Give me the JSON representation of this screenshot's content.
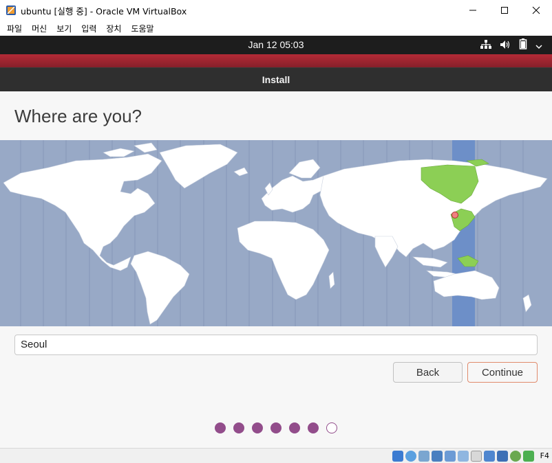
{
  "window": {
    "title": "ubuntu [실행 중] - Oracle VM VirtualBox",
    "controls": {
      "minimize": "─",
      "maximize": "☐",
      "close": "✕"
    }
  },
  "menu": [
    "파일",
    "머신",
    "보기",
    "입력",
    "장치",
    "도움말"
  ],
  "gnome": {
    "clock": "Jan 12  05:03",
    "tray_icons": [
      "network-icon",
      "volume-icon",
      "battery-icon",
      "system-menu-icon"
    ]
  },
  "installer": {
    "header_title": "Install",
    "heading": "Where are you?",
    "location_value": "Seoul",
    "back_label": "Back",
    "continue_label": "Continue",
    "progress": {
      "total_steps": 7,
      "current_step": 7
    }
  },
  "statusbar": {
    "host_key": "F4",
    "icons": [
      "hard-disk-icon",
      "optical-drive-icon",
      "audio-icon",
      "network-adapter-icon",
      "usb-icon",
      "shared-folder-icon",
      "display-icon",
      "recording-icon",
      "cpu-icon",
      "mouse-integration-icon",
      "arrow-icon"
    ]
  },
  "colors": {
    "accent_purple": "#924d8b",
    "continue_border": "#e08a6b",
    "ubuntu_red": "#a8243a",
    "map_ocean": "#98a9c6",
    "map_land": "#ffffff",
    "selected_zone": "#8ccf55",
    "timezone_band": "#6d8fc8"
  }
}
